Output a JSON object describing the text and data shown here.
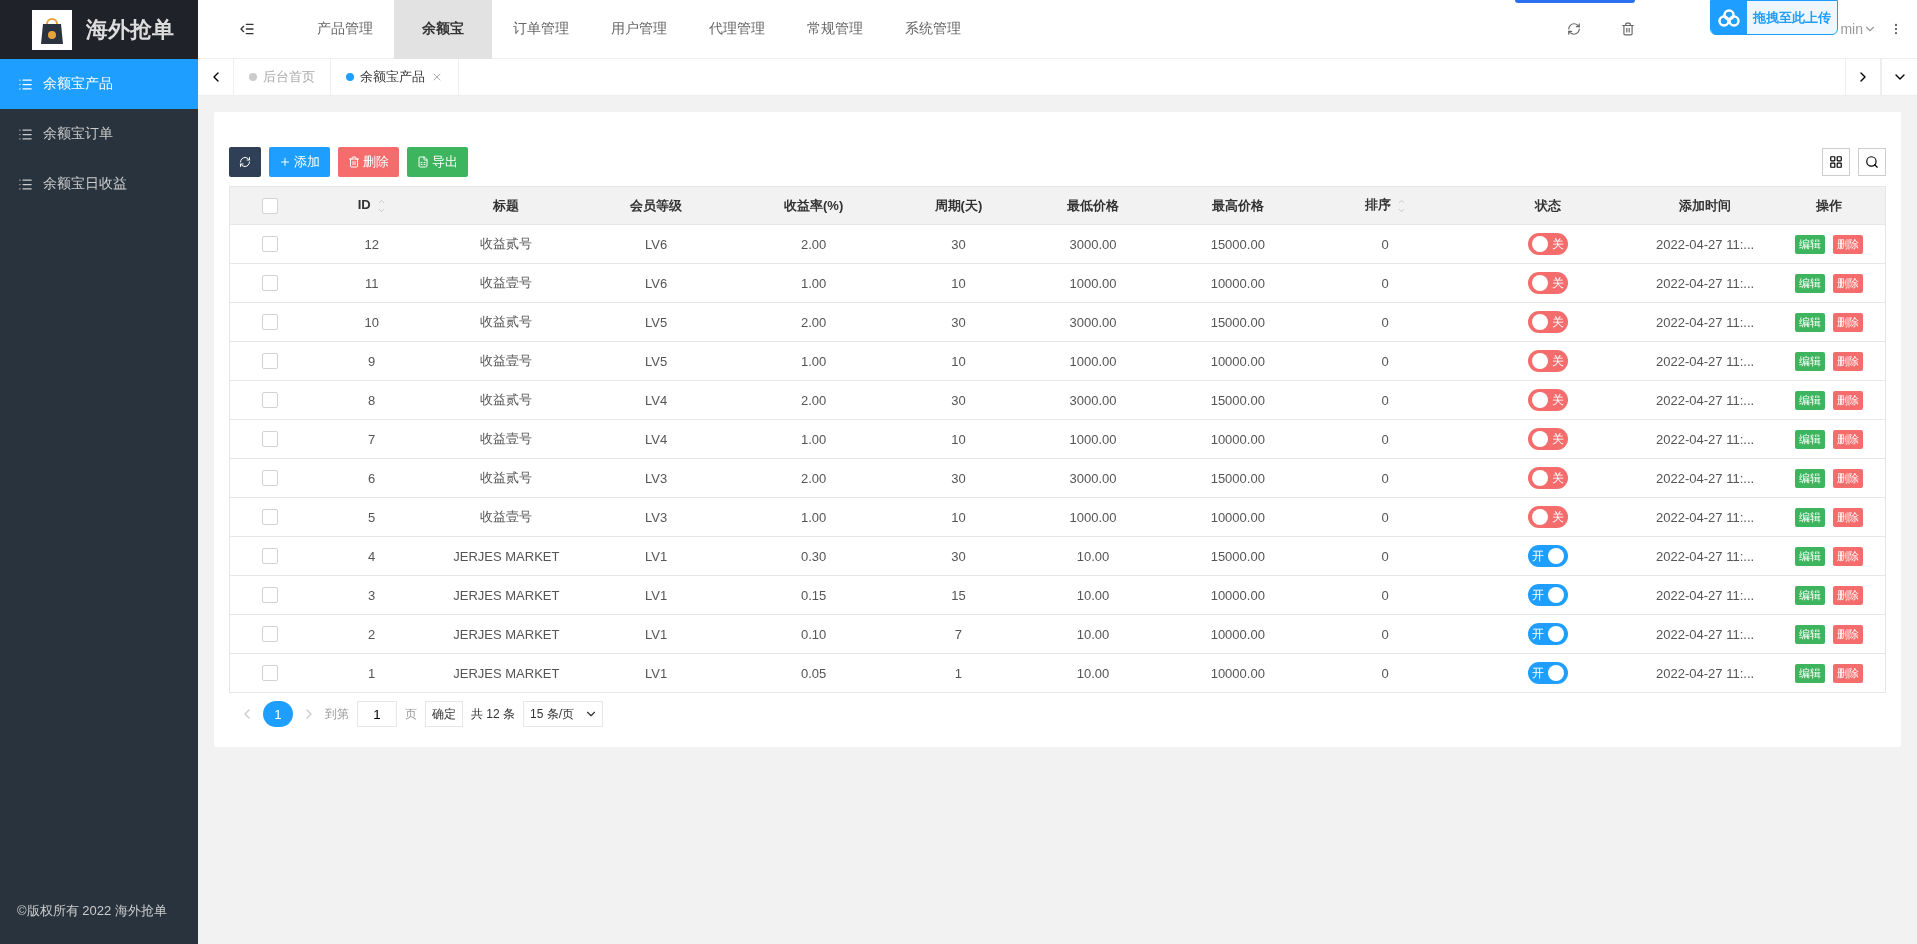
{
  "brand": {
    "title": "海外抢单"
  },
  "nav": [
    {
      "label": "产品管理",
      "selected": false
    },
    {
      "label": "余额宝",
      "selected": true
    },
    {
      "label": "订单管理",
      "selected": false
    },
    {
      "label": "用户管理",
      "selected": false
    },
    {
      "label": "代理管理",
      "selected": false
    },
    {
      "label": "常规管理",
      "selected": false
    },
    {
      "label": "系统管理",
      "selected": false
    }
  ],
  "user": {
    "name": "min"
  },
  "upload_widget": {
    "label": "拖拽至此上传"
  },
  "sidebar": {
    "items": [
      {
        "label": "余额宝产品",
        "selected": true
      },
      {
        "label": "余额宝订单",
        "selected": false
      },
      {
        "label": "余额宝日收益",
        "selected": false
      }
    ],
    "footer": "©版权所有 2022 海外抢单"
  },
  "page_tabs": [
    {
      "label": "后台首页",
      "selected": false,
      "closable": false
    },
    {
      "label": "余额宝产品",
      "selected": true,
      "closable": true
    }
  ],
  "toolbar": [
    {
      "kind": "refresh"
    },
    {
      "kind": "add",
      "label": "添加"
    },
    {
      "kind": "delete",
      "label": "删除"
    },
    {
      "kind": "export",
      "label": "导出"
    }
  ],
  "table": {
    "select_all_checked": false,
    "columns": [
      {
        "label": "ID",
        "sortable": true
      },
      {
        "label": "标题",
        "sortable": false
      },
      {
        "label": "会员等级",
        "sortable": false
      },
      {
        "label": "收益率(%)",
        "sortable": false
      },
      {
        "label": "周期(天)",
        "sortable": false
      },
      {
        "label": "最低价格",
        "sortable": false
      },
      {
        "label": "最高价格",
        "sortable": false
      },
      {
        "label": "排序",
        "sortable": true
      },
      {
        "label": "状态",
        "sortable": false
      },
      {
        "label": "添加时间",
        "sortable": false
      },
      {
        "label": "操作",
        "sortable": false
      }
    ],
    "rows": [
      {
        "checked": false,
        "cells": [
          "12",
          "收益贰号",
          "LV6",
          "2.00",
          "30",
          "3000.00",
          "15000.00",
          "0"
        ],
        "status": {
          "on": false,
          "label": "关"
        },
        "time": "2022-04-27 11:...",
        "actions": [
          "编辑",
          "删除"
        ]
      },
      {
        "checked": false,
        "cells": [
          "11",
          "收益壹号",
          "LV6",
          "1.00",
          "10",
          "1000.00",
          "10000.00",
          "0"
        ],
        "status": {
          "on": false,
          "label": "关"
        },
        "time": "2022-04-27 11:...",
        "actions": [
          "编辑",
          "删除"
        ]
      },
      {
        "checked": false,
        "cells": [
          "10",
          "收益贰号",
          "LV5",
          "2.00",
          "30",
          "3000.00",
          "15000.00",
          "0"
        ],
        "status": {
          "on": false,
          "label": "关"
        },
        "time": "2022-04-27 11:...",
        "actions": [
          "编辑",
          "删除"
        ]
      },
      {
        "checked": false,
        "cells": [
          "9",
          "收益壹号",
          "LV5",
          "1.00",
          "10",
          "1000.00",
          "10000.00",
          "0"
        ],
        "status": {
          "on": false,
          "label": "关"
        },
        "time": "2022-04-27 11:...",
        "actions": [
          "编辑",
          "删除"
        ]
      },
      {
        "checked": false,
        "cells": [
          "8",
          "收益贰号",
          "LV4",
          "2.00",
          "30",
          "3000.00",
          "15000.00",
          "0"
        ],
        "status": {
          "on": false,
          "label": "关"
        },
        "time": "2022-04-27 11:...",
        "actions": [
          "编辑",
          "删除"
        ]
      },
      {
        "checked": false,
        "cells": [
          "7",
          "收益壹号",
          "LV4",
          "1.00",
          "10",
          "1000.00",
          "10000.00",
          "0"
        ],
        "status": {
          "on": false,
          "label": "关"
        },
        "time": "2022-04-27 11:...",
        "actions": [
          "编辑",
          "删除"
        ]
      },
      {
        "checked": false,
        "cells": [
          "6",
          "收益贰号",
          "LV3",
          "2.00",
          "30",
          "3000.00",
          "15000.00",
          "0"
        ],
        "status": {
          "on": false,
          "label": "关"
        },
        "time": "2022-04-27 11:...",
        "actions": [
          "编辑",
          "删除"
        ]
      },
      {
        "checked": false,
        "cells": [
          "5",
          "收益壹号",
          "LV3",
          "1.00",
          "10",
          "1000.00",
          "10000.00",
          "0"
        ],
        "status": {
          "on": false,
          "label": "关"
        },
        "time": "2022-04-27 11:...",
        "actions": [
          "编辑",
          "删除"
        ]
      },
      {
        "checked": false,
        "cells": [
          "4",
          "JERJES MARKET",
          "LV1",
          "0.30",
          "30",
          "10.00",
          "15000.00",
          "0"
        ],
        "status": {
          "on": true,
          "label": "开"
        },
        "time": "2022-04-27 11:...",
        "actions": [
          "编辑",
          "删除"
        ]
      },
      {
        "checked": false,
        "cells": [
          "3",
          "JERJES MARKET",
          "LV1",
          "0.15",
          "15",
          "10.00",
          "10000.00",
          "0"
        ],
        "status": {
          "on": true,
          "label": "开"
        },
        "time": "2022-04-27 11:...",
        "actions": [
          "编辑",
          "删除"
        ]
      },
      {
        "checked": false,
        "cells": [
          "2",
          "JERJES MARKET",
          "LV1",
          "0.10",
          "7",
          "10.00",
          "10000.00",
          "0"
        ],
        "status": {
          "on": true,
          "label": "开"
        },
        "time": "2022-04-27 11:...",
        "actions": [
          "编辑",
          "删除"
        ]
      },
      {
        "checked": false,
        "cells": [
          "1",
          "JERJES MARKET",
          "LV1",
          "0.05",
          "1",
          "10.00",
          "10000.00",
          "0"
        ],
        "status": {
          "on": true,
          "label": "开"
        },
        "time": "2022-04-27 11:...",
        "actions": [
          "编辑",
          "删除"
        ]
      }
    ]
  },
  "pagination": {
    "pages": [
      {
        "label": "1",
        "selected": true
      }
    ],
    "goto_label": "到第",
    "goto_value": "1",
    "page_unit": "页",
    "confirm": "确定",
    "total": "共 12 条",
    "page_size": "15 条/页"
  }
}
